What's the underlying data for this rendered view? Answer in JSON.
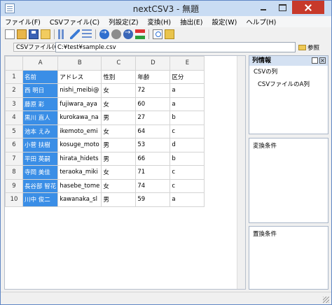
{
  "window": {
    "title": "nextCSV3 - 無題"
  },
  "menu": [
    "ファイル(F)",
    "CSVファイル(C)",
    "列設定(Z)",
    "変換(H)",
    "抽出(E)",
    "設定(W)",
    "ヘルプ(H)"
  ],
  "toolbar": {
    "icons": [
      "new-file-icon",
      "open-file-icon",
      "save-icon",
      "folder-icon",
      "column-settings-icon",
      "edit-icon",
      "row-settings-icon",
      "convert-run-icon",
      "stop-icon",
      "play-icon",
      "transform-icon",
      "search-icon",
      "search-folder-icon"
    ]
  },
  "file": {
    "label": "CSVファイル(C)",
    "path": "C:¥test¥sample.csv",
    "browse_label": "参照"
  },
  "grid": {
    "columns": [
      "A",
      "B",
      "C",
      "D",
      "E"
    ],
    "rows": [
      [
        "1",
        "名前",
        "アドレス",
        "性別",
        "年齢",
        "区分"
      ],
      [
        "2",
        "西 明日",
        "nishi_meibi@",
        "女",
        "72",
        "a"
      ],
      [
        "3",
        "藤原 彩",
        "fujiwara_aya",
        "女",
        "60",
        "a"
      ],
      [
        "4",
        "黒川 直人",
        "kurokawa_na",
        "男",
        "27",
        "b"
      ],
      [
        "5",
        "池本 えみ",
        "ikemoto_emi",
        "女",
        "64",
        "c"
      ],
      [
        "6",
        "小菅 扶樹",
        "kosuge_moto",
        "男",
        "53",
        "d"
      ],
      [
        "7",
        "平田 英嗣",
        "hirata_hidets",
        "男",
        "66",
        "b"
      ],
      [
        "8",
        "寺岡 美佳",
        "teraoka_miki",
        "女",
        "71",
        "c"
      ],
      [
        "9",
        "長谷部 智花",
        "hasebe_tome",
        "女",
        "74",
        "c"
      ],
      [
        "10",
        "川中 俊二",
        "kawanaka_sl",
        "男",
        "59",
        "a"
      ]
    ]
  },
  "panels": {
    "columns": {
      "title": "列情報",
      "sub": "CSVの列",
      "item": "CSVファイルのA列"
    },
    "convert": {
      "title": "変換条件"
    },
    "replace": {
      "title": "置換条件"
    }
  }
}
